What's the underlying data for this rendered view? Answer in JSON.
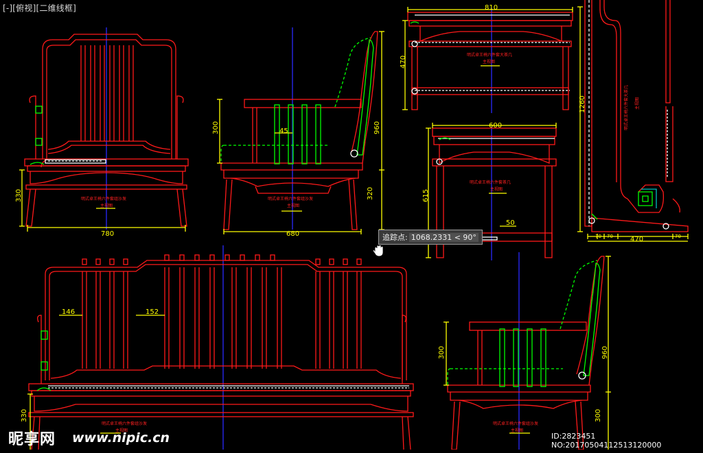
{
  "viewport_label": "[-][俯视][二维线框]",
  "tooltip": {
    "label": "追踪点:",
    "value": "1068.2331 < 90°"
  },
  "watermark": {
    "logo": "昵享网",
    "url": "www.nipic.cn",
    "id": "ID:2823451 NO:20170504112513120000"
  },
  "dimensions": {
    "armchair_front_width": "780",
    "armchair_front_seat": "330",
    "armchair_side_depth": "680",
    "armchair_side_back": "300",
    "armchair_side_height": "960",
    "armchair_side_leg": "320",
    "armchair_side_slat": "45",
    "table_top_width": "810",
    "table_top_depth": "470",
    "table_front_width": "600",
    "table_front_height": "615",
    "table_front_slat": "50",
    "section_height": "1260",
    "section_width": "470",
    "section_a": "70",
    "section_b": "70",
    "section_c": "70",
    "sofa_gap_left": "146",
    "sofa_gap_mid": "152",
    "sofa_seat": "330",
    "sofa_side_back": "300",
    "sofa_side_height": "960",
    "sofa_side_leg": "300"
  },
  "drawing_titles": {
    "armchair_front": "明式卓王椅六件套组沙发",
    "armchair_side": "明式卓王椅六件套组沙发",
    "table_top": "明式卓王椅六件套大茶几",
    "table_front": "明式卓王椅六件套茶几",
    "section": "明式卓王椅六件套大茶几",
    "sofa_front": "明式卓王椅六件套组沙发",
    "sofa_side": "明式卓王椅六件套组沙发",
    "subtitle": "主视图"
  },
  "colors": {
    "frame": "#ff1a1a",
    "dimension": "#ffff00",
    "centerline": "#2a2aff",
    "cushion": "#00ff00",
    "background": "#000000"
  }
}
